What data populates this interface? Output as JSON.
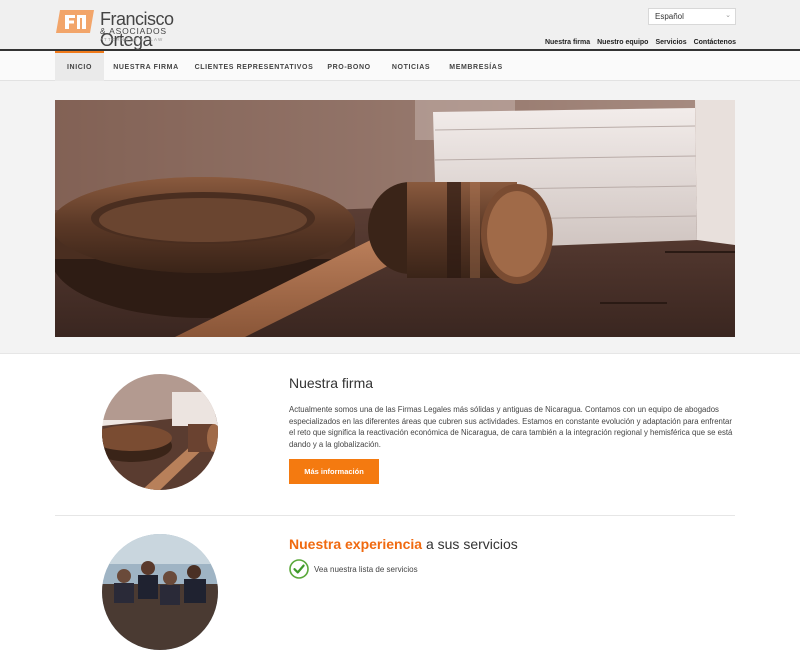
{
  "header": {
    "brand_name": "Francisco Ortega",
    "brand_sub": "& ASOCIADOS",
    "brand_tag": "ATTORNEYS AT LAW",
    "language": "Español",
    "util_links": [
      "Nuestra firma",
      "Nuestro equipo",
      "Servicios",
      "Contáctenos"
    ]
  },
  "nav": {
    "items": [
      "INICIO",
      "NUESTRA FIRMA",
      "CLIENTES REPRESENTATIVOS",
      "PRO-BONO",
      "NOTICIAS",
      "MEMBRESÍAS"
    ],
    "active": "INICIO"
  },
  "firm": {
    "title": "Nuestra firma",
    "text": "Actualmente somos una de las Firmas Legales más sólidas y  antiguas de Nicaragua.  Contamos con un equipo de abogados especializados en las diferentes áreas que cubren sus actividades. Estamos en constante evolución y adaptación para enfrentar el reto que  significa la reactivación económica de Nicaragua, de cara también a la integración regional y hemisférica que se está dando y a la globalización.",
    "button": "Más información"
  },
  "experience": {
    "title_accent": "Nuestra experiencia",
    "title_rest": " a sus servicios",
    "link": "Vea nuestra lista de servicios"
  },
  "colors": {
    "accent": "#f47a10",
    "header_bg": "#f0f0f0",
    "text": "#333333"
  }
}
